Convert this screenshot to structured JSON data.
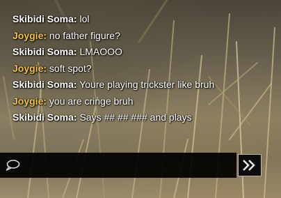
{
  "chat": {
    "colors": {
      "player_a": "#ffffff",
      "player_b": "#f2c24a",
      "message": "#ffffff"
    },
    "messages": [
      {
        "speaker": "Skibidi Soma:",
        "text": " lol",
        "speaker_color": "#ffffff"
      },
      {
        "speaker": "Joygie:",
        "text": " no father figure?",
        "speaker_color": "#f2c24a"
      },
      {
        "speaker": "Skibidi Soma:",
        "text": " LMAOOO",
        "speaker_color": "#ffffff"
      },
      {
        "speaker": "Joygie:",
        "text": " soft spot?",
        "speaker_color": "#f2c24a"
      },
      {
        "speaker": "Skibidi Soma:",
        "text": " Youre playing trickster like bruh",
        "speaker_color": "#ffffff"
      },
      {
        "speaker": "Joygie:",
        "text": " you are cringe bruh",
        "speaker_color": "#f2c24a"
      },
      {
        "speaker": "Skibidi Soma:",
        "text": " Says ## ## ### and plays",
        "speaker_color": "#ffffff"
      }
    ],
    "input": {
      "value": "",
      "icon": "chat-bubble-icon"
    },
    "send_button": {
      "icon": "double-chevron-right-icon"
    }
  }
}
